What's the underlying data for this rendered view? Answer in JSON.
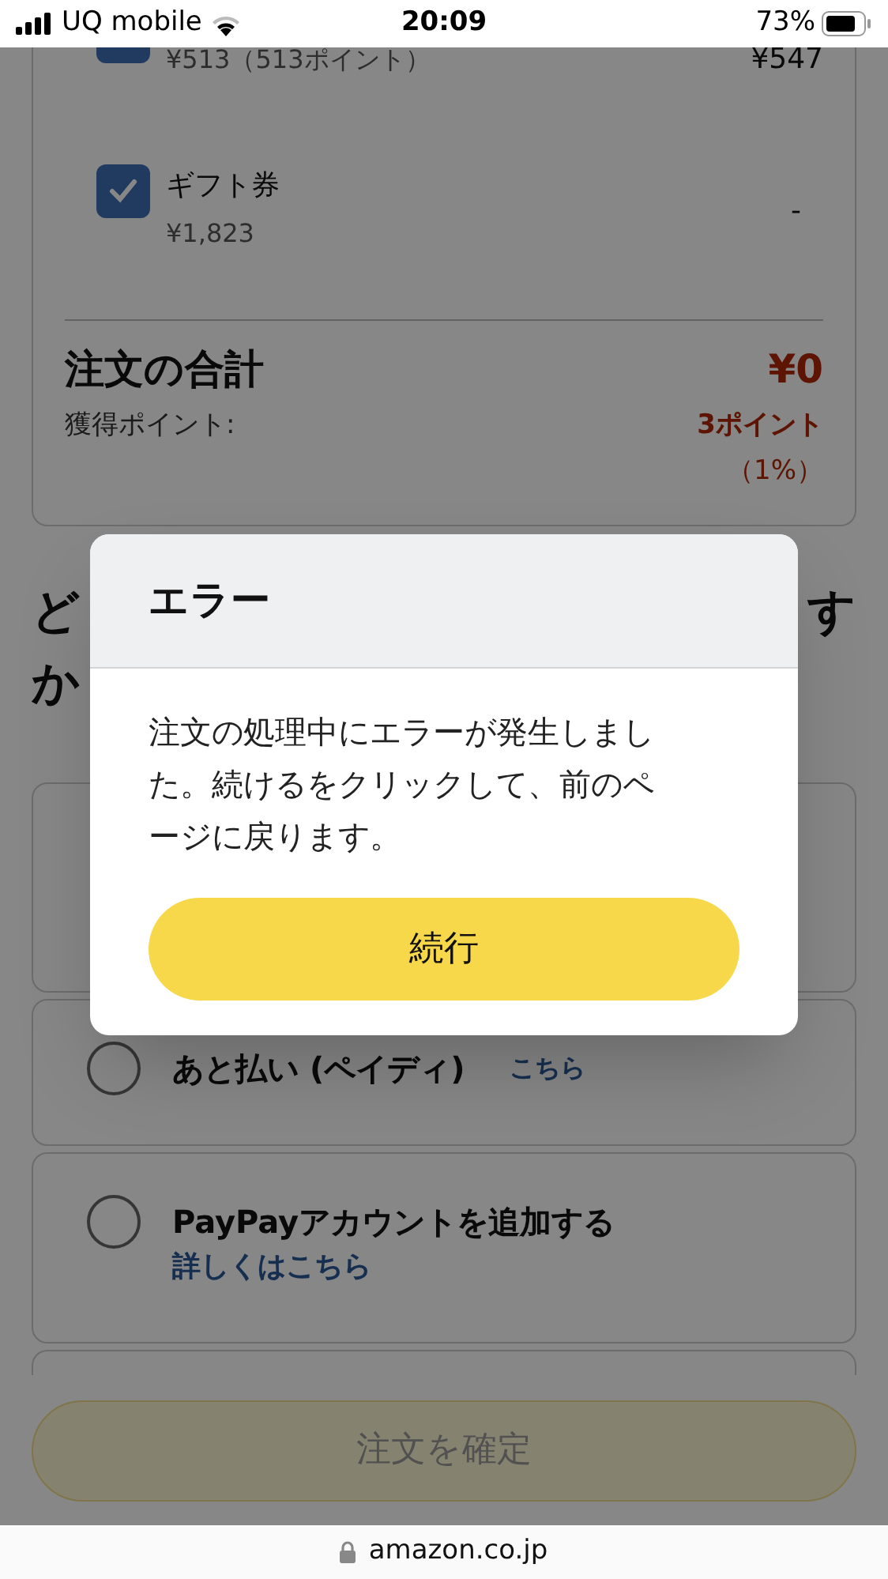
{
  "status_bar": {
    "carrier": "UQ mobile",
    "time": "20:09",
    "battery": "73%"
  },
  "payment_items": [
    {
      "price": "¥513（513ポイント）",
      "amount": "¥547",
      "checked": true
    },
    {
      "label": "ギフト券",
      "price": "¥1,823",
      "amount": "-",
      "checked": true
    }
  ],
  "order_total": {
    "label": "注文の合計",
    "amount": "¥0",
    "points_label": "獲得ポイント:",
    "points": "3ポイント",
    "points_rate": "（1%）"
  },
  "heading_fragments": {
    "left_line_1": "ど",
    "right_line_1": "す",
    "left_line_2": "か"
  },
  "payment_options": [
    {
      "kind": "inline-link",
      "name": "あと払い (ペイディ)",
      "link": "こちら",
      "selected": false
    },
    {
      "kind": "link-below",
      "name": "PayPayアカウントを追加する",
      "link": "詳しくはこちら",
      "selected": false
    }
  ],
  "place_order_button": {
    "label": "注文を確定",
    "disabled": true
  },
  "dialog": {
    "title": "エラー",
    "message": "注文の処理中にエラーが発生しました。続けるをクリックして、前のページに戻ります。",
    "button": "続行"
  },
  "address_bar": {
    "url": "amazon.co.jp"
  }
}
